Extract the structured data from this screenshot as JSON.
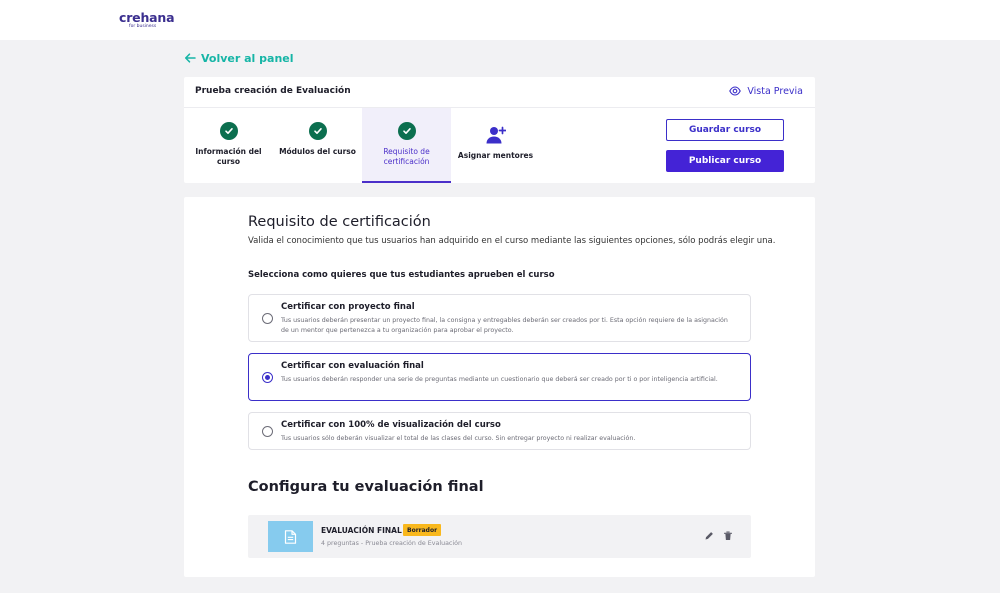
{
  "brand": {
    "name": "crehana",
    "sub": "for business"
  },
  "back_link": "Volver al panel",
  "header": {
    "course_title": "Prueba creación de Evaluación",
    "preview_label": "Vista Previa",
    "steps": [
      {
        "label": "Información del curso",
        "state": "done"
      },
      {
        "label": "Módulos del curso",
        "state": "done"
      },
      {
        "label": "Requisito de certificación",
        "state": "active"
      },
      {
        "label": "Asignar mentores",
        "state": "todo"
      }
    ],
    "save_label": "Guardar curso",
    "publish_label": "Publicar curso"
  },
  "certification": {
    "title": "Requisito de certificación",
    "description": "Valida el conocimiento que tus usuarios han adquirido en el curso mediante las siguientes opciones, sólo podrás elegir una.",
    "choose_label": "Selecciona como quieres que tus estudiantes aprueben el curso",
    "options": [
      {
        "title": "Certificar con proyecto final",
        "description": "Tus usuarios deberán presentar un proyecto final, la consigna y entregables deberán ser creados por ti. Esta opción requiere de la asignación de un mentor que pertenezca a tu organización para aprobar el proyecto.",
        "selected": false
      },
      {
        "title": "Certificar con evaluación final",
        "description": "Tus usuarios deberán responder una serie de preguntas mediante un cuestionario que deberá ser creado por ti o por inteligencia artificial.",
        "selected": true
      },
      {
        "title": "Certificar con 100% de visualización del curso",
        "description": "Tus usuarios sólo deberán visualizar el total de las clases del curso. Sin entregar proyecto ni realizar evaluación.",
        "selected": false
      }
    ]
  },
  "config": {
    "title": "Configura tu evaluación final",
    "evaluation": {
      "name": "EVALUACIÓN FINAL",
      "badge": "Borrador",
      "meta": "4 preguntas - Prueba creación de Evaluación"
    }
  },
  "colors": {
    "accent": "#4423d6",
    "teal": "#16b5a6",
    "check": "#0c6f4f",
    "badge": "#f9b81d",
    "thumb": "#86cbee"
  }
}
